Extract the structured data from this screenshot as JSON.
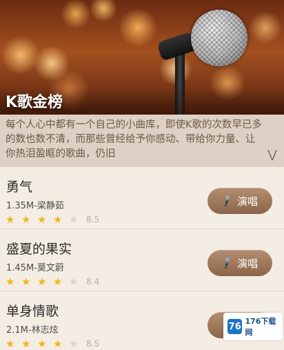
{
  "header": {
    "title": "K歌金榜"
  },
  "description": {
    "text": "每个人心中都有一个自己的小曲库，即使K歌的次数早已多的数也数不清，而那些曾经给予你感动、带给你力量、让你热泪盈眶的歌曲，仍旧"
  },
  "songs": [
    {
      "title": "勇气",
      "meta": "1.35M-梁静茹",
      "rating": "8.5",
      "button": "演唱"
    },
    {
      "title": "盛夏的果实",
      "meta": "1.45M-莫文蔚",
      "rating": "8.4",
      "button": "演唱"
    },
    {
      "title": "单身情歌",
      "meta": "2.1M-林志炫",
      "rating": "8.5",
      "button": "演唱"
    }
  ],
  "watermark": {
    "text": "176下载网"
  },
  "colors": {
    "star": "#f3b41b",
    "button": "#9c7557"
  }
}
